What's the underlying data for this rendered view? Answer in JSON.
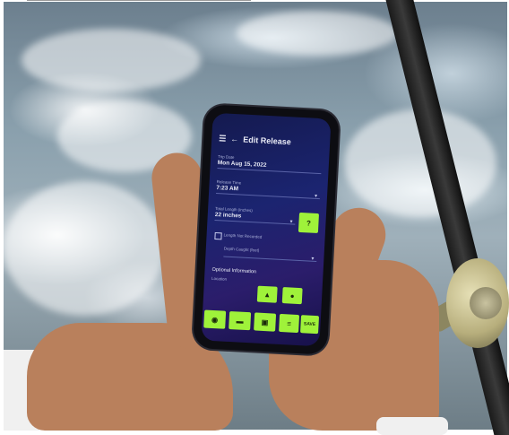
{
  "app": {
    "title": "Edit Release"
  },
  "form": {
    "trip_date": {
      "label": "Trip Date",
      "value": "Mon Aug 15, 2022"
    },
    "release_time": {
      "label": "Release Time",
      "value": "7:23 AM"
    },
    "length": {
      "label": "Total Length (inches)",
      "value": "22 inches",
      "help_label": "?"
    },
    "length_not_recorded_label": "Length Not Recorded",
    "depth_label": "Depth Caught (feet)",
    "optional_label": "Optional Information",
    "location_label": "Location"
  },
  "actions": {
    "save_label": "SAVE"
  },
  "icons": {
    "menu": "menu-icon",
    "back": "back-arrow-icon",
    "camera": "camera-icon",
    "map": "map-pin-icon",
    "measure": "ruler-icon",
    "gallery": "image-icon",
    "list": "list-icon"
  },
  "colors": {
    "accent": "#9ff23a",
    "screen_bg": "#1b2470",
    "text": "#e8eaf5"
  }
}
